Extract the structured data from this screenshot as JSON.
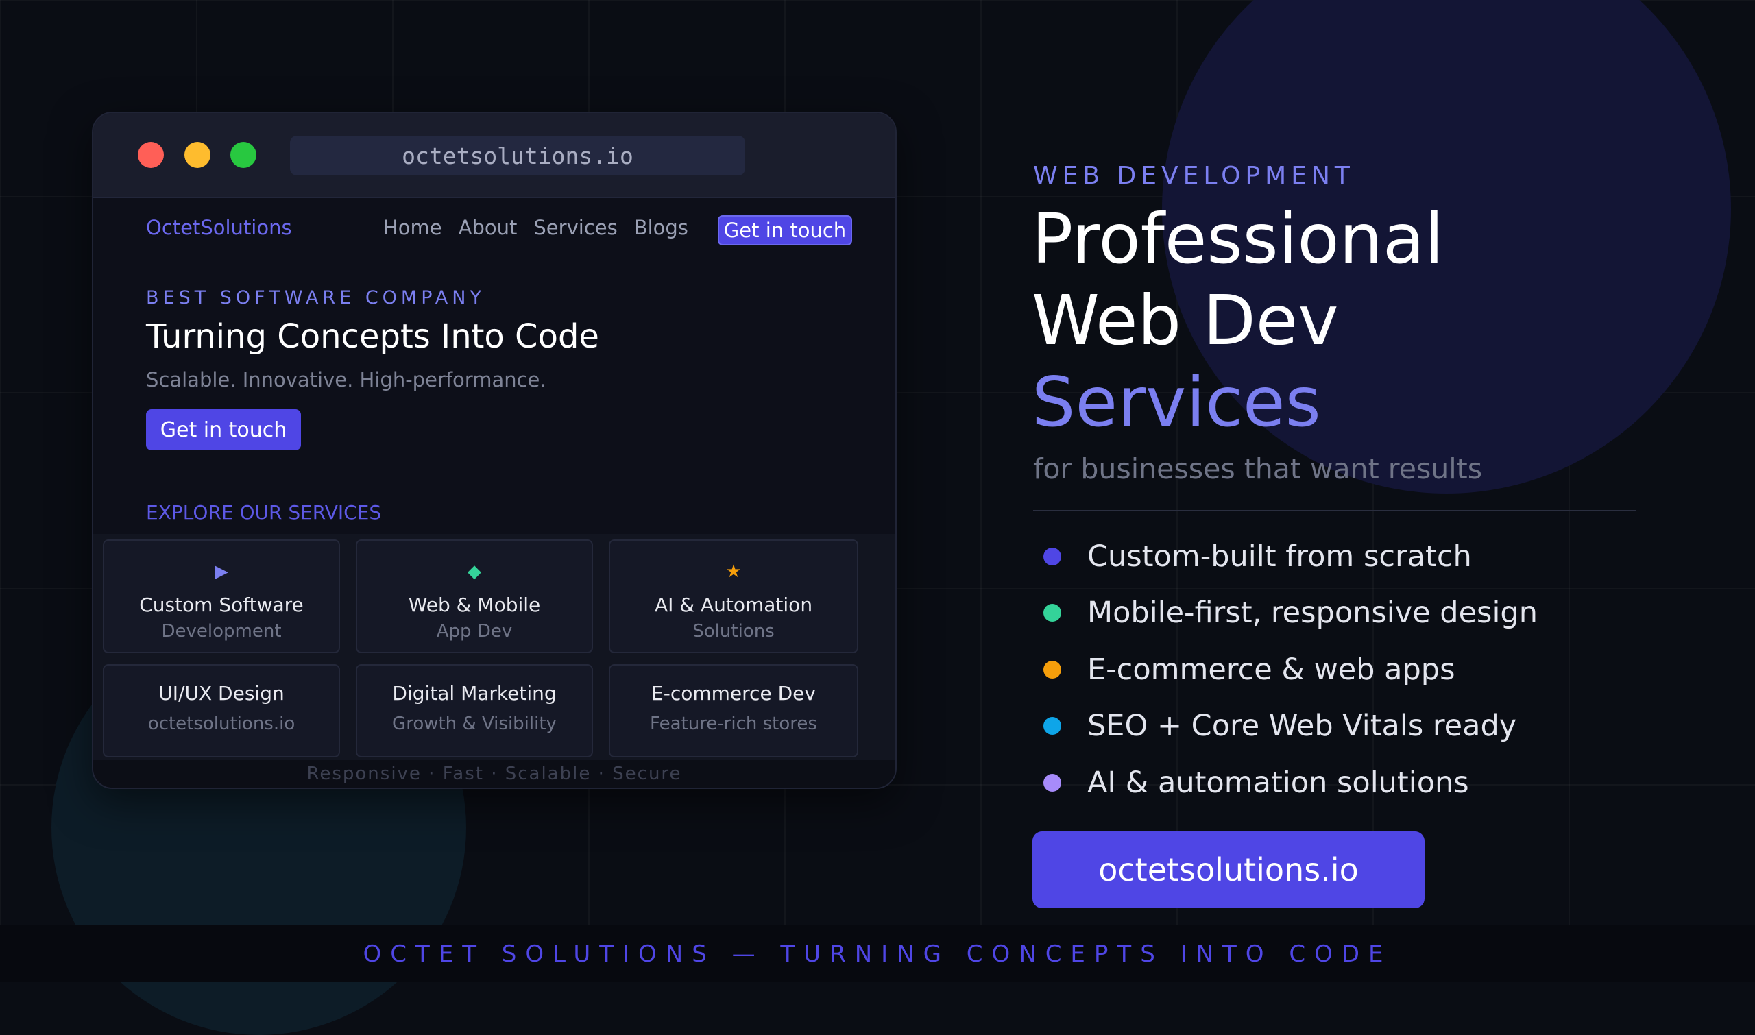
{
  "browser": {
    "url": "octetsolutions.io",
    "site": {
      "logo": "OctetSolutions",
      "nav": [
        "Home",
        "About",
        "Services",
        "Blogs"
      ],
      "nav_button": "Get in touch",
      "eyebrow": "BEST SOFTWARE COMPANY",
      "title": "Turning Concepts Into Code",
      "subtitle": "Scalable. Innovative. High-performance.",
      "hero_button": "Get in touch",
      "explore_label": "EXPLORE OUR SERVICES",
      "services": [
        {
          "icon": "play-icon",
          "glyph": "▶",
          "title": "Custom Software",
          "subtitle": "Development"
        },
        {
          "icon": "diamond-icon",
          "glyph": "◆",
          "title": "Web & Mobile",
          "subtitle": "App Dev"
        },
        {
          "icon": "star-icon",
          "glyph": "★",
          "title": "AI & Automation",
          "subtitle": "Solutions"
        },
        {
          "title": "UI/UX Design",
          "subtitle": "octetsolutions.io"
        },
        {
          "title": "Digital Marketing",
          "subtitle": "Growth & Visibility"
        },
        {
          "title": "E-commerce Dev",
          "subtitle": "Feature-rich stores"
        }
      ],
      "tagline": "Responsive · Fast · Scalable · Secure"
    }
  },
  "hero": {
    "eyebrow": "WEB DEVELOPMENT",
    "title_line1": "Professional",
    "title_line2": "Web Dev",
    "title_line3": "Services",
    "subtitle": "for businesses that want results"
  },
  "features": [
    {
      "text": "Custom-built from scratch",
      "color": "#4f46e5"
    },
    {
      "text": "Mobile-first, responsive design",
      "color": "#34d399"
    },
    {
      "text": "E-commerce & web apps",
      "color": "#f59e0b"
    },
    {
      "text": "SEO + Core Web Vitals ready",
      "color": "#0ea5e9"
    },
    {
      "text": "AI & automation solutions",
      "color": "#a78bfa"
    }
  ],
  "cta": "octetsolutions.io",
  "footer": "OCTET SOLUTIONS — TURNING CONCEPTS INTO CODE",
  "colors": {
    "accent": "#4f46e5",
    "accent_light": "#7b7ff0",
    "background": "#0a0d14"
  }
}
